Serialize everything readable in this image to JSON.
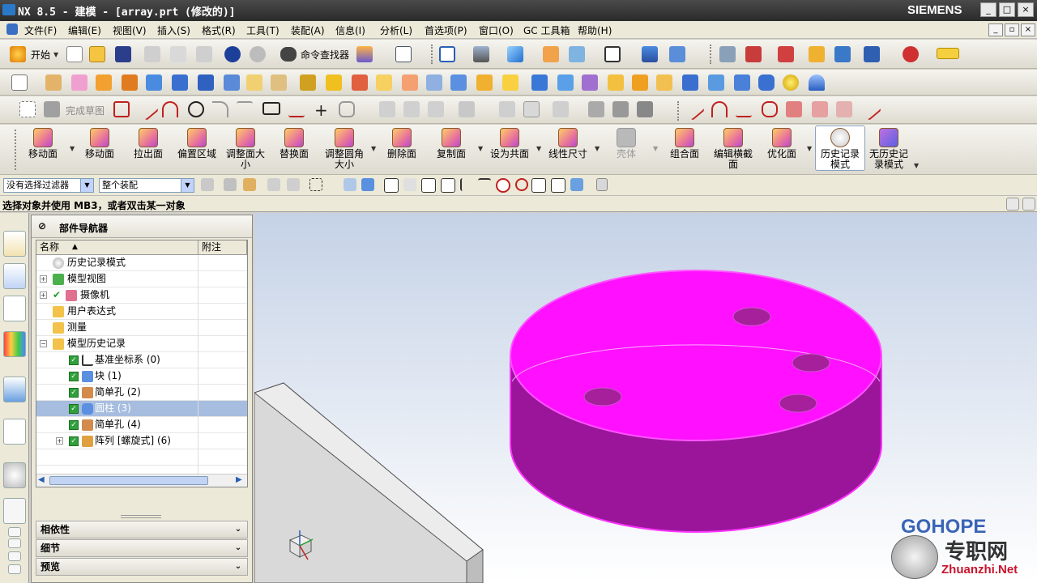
{
  "titlebar": {
    "title": "NX 8.5 - 建模 - [array.prt (修改的)]",
    "brand": "SIEMENS",
    "min": "_",
    "max": "□",
    "close": "×"
  },
  "menu": {
    "items": [
      "文件(F)",
      "编辑(E)",
      "视图(V)",
      "插入(S)",
      "格式(R)",
      "工具(T)",
      "装配(A)",
      "信息(I)",
      "分析(L)",
      "首选项(P)",
      "窗口(O)",
      "GC 工具箱",
      "帮助(H)"
    ]
  },
  "toolbar1": {
    "start": "开始",
    "command_finder": "命令查找器"
  },
  "toolbar3": {
    "finish_sketch": "完成草图"
  },
  "sync_toolbar": {
    "buttons": [
      {
        "label": "移动面"
      },
      {
        "label": "移动面"
      },
      {
        "label": "拉出面"
      },
      {
        "label": "偏置区域"
      },
      {
        "label": "调整面大小",
        "l1": "调整面大",
        "l2": "小"
      },
      {
        "label": "替换面"
      },
      {
        "label": "调整圆角大小",
        "l1": "调整圆角",
        "l2": "大小"
      },
      {
        "label": "删除面"
      },
      {
        "label": "复制面"
      },
      {
        "label": "设为共面"
      },
      {
        "label": "线性尺寸"
      },
      {
        "label": "壳体"
      },
      {
        "label": "组合面"
      },
      {
        "label": "优化面"
      },
      {
        "label": "历史记录模式",
        "l1": "历史记录",
        "l2": "模式"
      },
      {
        "label": "无历史记录模式",
        "l1": "无历史记",
        "l2": "录模式"
      }
    ],
    "tiled_label": {
      "l1": "编辑横截",
      "l2": "面"
    }
  },
  "selection_bar": {
    "filter": "没有选择过滤器",
    "scope": "整个装配"
  },
  "status": {
    "text": "选择对象并使用 MB3，或者双击某一对象"
  },
  "navigator": {
    "title": "部件导航器",
    "col_name": "名称",
    "col_attach": "附注",
    "rows": [
      {
        "label": "历史记录模式"
      },
      {
        "label": "模型视图"
      },
      {
        "label": "摄像机"
      },
      {
        "label": "用户表达式"
      },
      {
        "label": "测量"
      },
      {
        "label": "模型历史记录"
      },
      {
        "label": "基准坐标系 (0)"
      },
      {
        "label": "块 (1)"
      },
      {
        "label": "简单孔 (2)"
      },
      {
        "label": "圆柱 (3)"
      },
      {
        "label": "简单孔 (4)"
      },
      {
        "label": "阵列 [螺旋式] (6)"
      }
    ],
    "panels": [
      "相依性",
      "细节",
      "预览"
    ]
  },
  "watermark": {
    "brand": "GOHOPE",
    "site": "Zhuanzhi.Net",
    "cn": "专职网"
  },
  "colors": {
    "part_top": "#ff00ff",
    "part_side": "#9e0f9e",
    "selected_row": "#a7bde0"
  }
}
